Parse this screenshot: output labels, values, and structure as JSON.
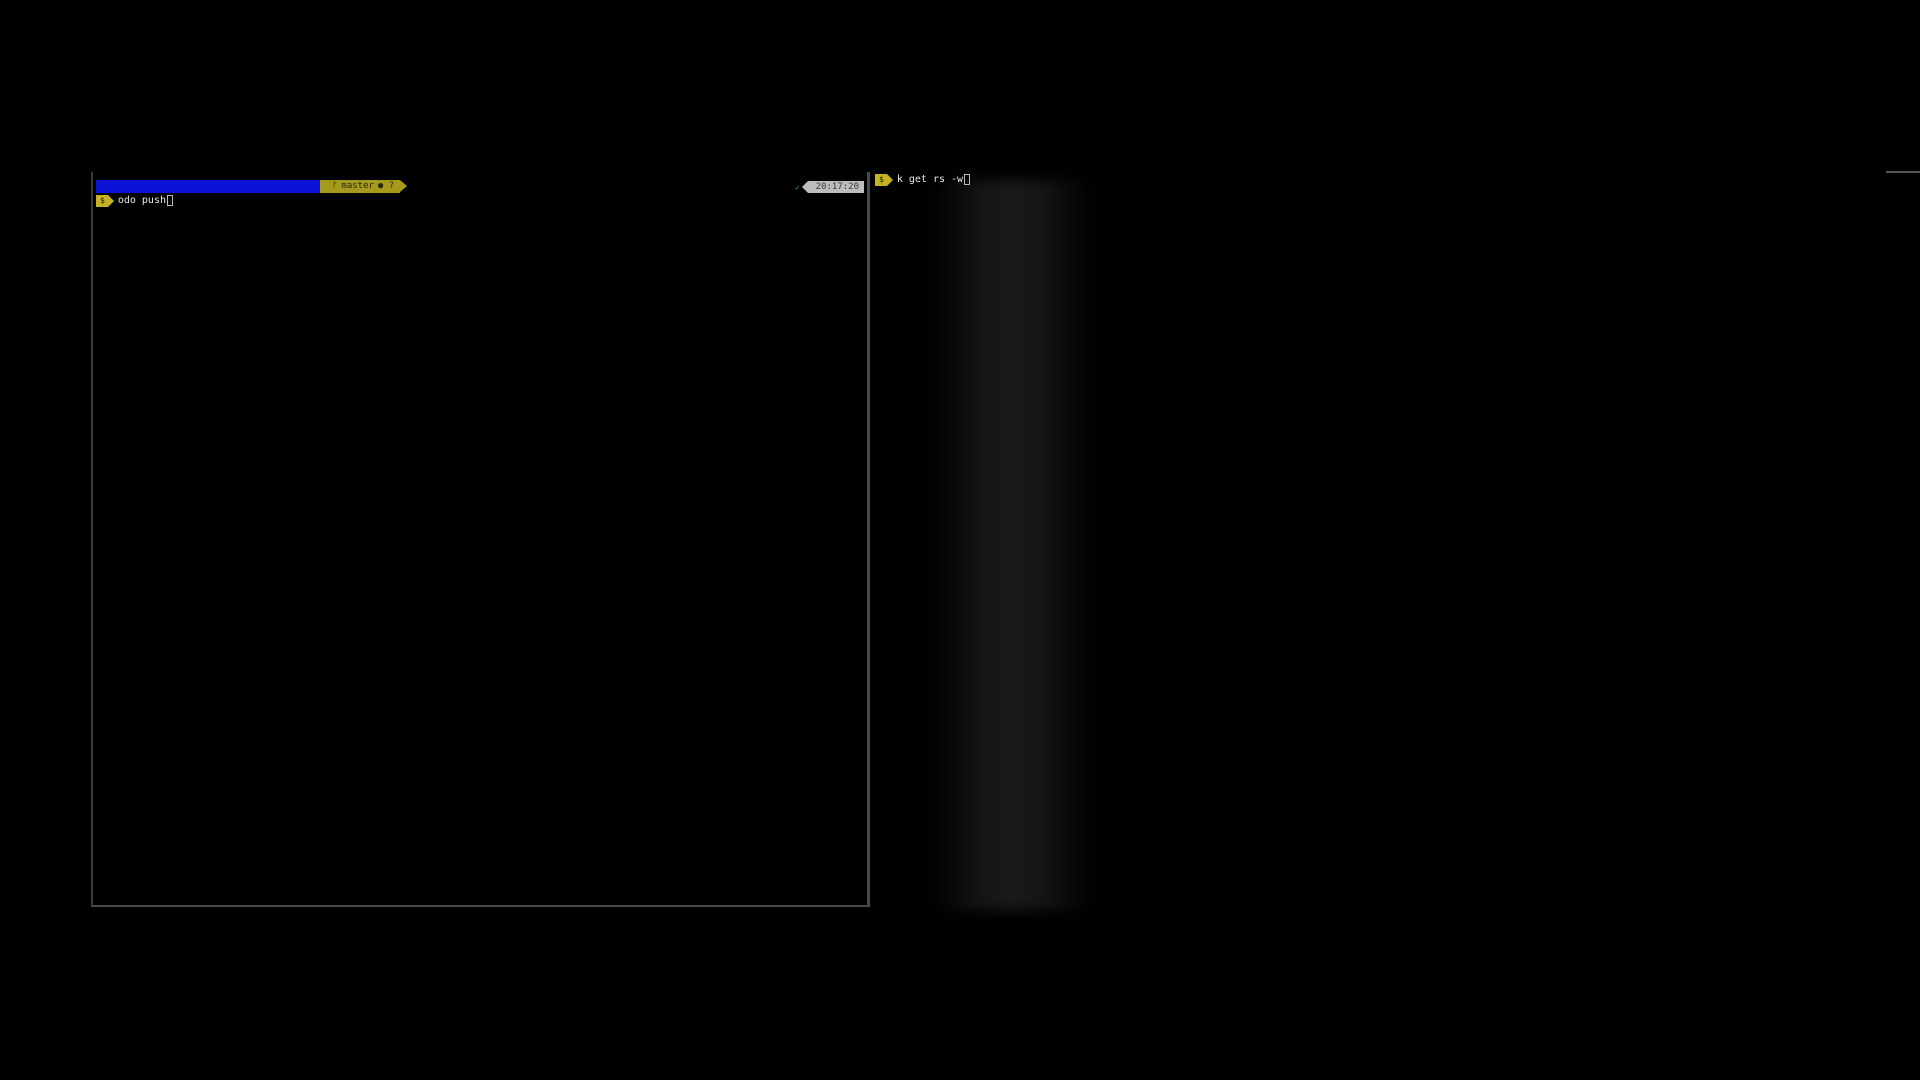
{
  "left_terminal": {
    "git_branch": "master",
    "git_status": "● ?",
    "time": "20:17:20",
    "check_mark": "✓",
    "prompt_symbol": "$",
    "command": "odo push"
  },
  "right_terminal": {
    "prompt_symbol": "$",
    "command": "k get rs -w"
  },
  "colors": {
    "background": "#000000",
    "path_segment": "#0c12d6",
    "git_segment": "#a59a1c",
    "prompt_badge": "#c7b320",
    "time_segment": "#bdbdbd",
    "text": "#e8e8e8"
  }
}
